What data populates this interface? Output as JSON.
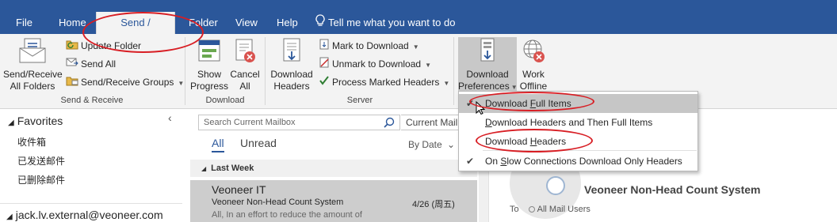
{
  "tabs": [
    {
      "label": "File"
    },
    {
      "label": "Home"
    },
    {
      "label": "Send / Receive"
    },
    {
      "label": "Folder"
    },
    {
      "label": "View"
    },
    {
      "label": "Help"
    }
  ],
  "tell_me": "Tell me what you want to do",
  "ribbon": {
    "send_receive_all": [
      "Send/Receive",
      "All Folders"
    ],
    "update_folder": "Update Folder",
    "send_all": "Send All",
    "send_receive_groups": "Send/Receive Groups",
    "group_send_receive": "Send & Receive",
    "show_progress": [
      "Show",
      "Progress"
    ],
    "cancel_all": [
      "Cancel",
      "All"
    ],
    "group_download": "Download",
    "download_headers": [
      "Download",
      "Headers"
    ],
    "mark_to_download": "Mark to Download",
    "unmark_to_download": "Unmark to Download",
    "process_marked_headers": "Process Marked Headers",
    "group_server": "Server",
    "download_preferences": [
      "Download",
      "Preferences"
    ],
    "work_offline": [
      "Work",
      "Offline"
    ]
  },
  "dropdown": {
    "item1": {
      "pre": "Download ",
      "u": "F",
      "post": "ull Items"
    },
    "item2": {
      "pre": "",
      "u": "D",
      "post": "ownload Headers and Then Full Items"
    },
    "item3": {
      "pre": "Download ",
      "u": "H",
      "post": "eaders"
    },
    "item4": {
      "pre": "On ",
      "u": "S",
      "post": "low Connections Download Only Headers"
    }
  },
  "folders": {
    "favorites": "Favorites",
    "items": [
      "收件箱",
      "已发送邮件",
      "已删除邮件"
    ],
    "account": "jack.lv.external@veoneer.com"
  },
  "mail_list": {
    "search_placeholder": "Search Current Mailbox",
    "scope": "Current Mailbox",
    "filter_all": "All",
    "filter_unread": "Unread",
    "sort": "By Date",
    "group": "Last Week",
    "message": {
      "from": "Veoneer IT",
      "subject": "Veoneer Non-Head Count System",
      "date": "4/26 (周五)",
      "preview": "All,  In an effort to reduce the amount of"
    }
  },
  "reading_pane": {
    "title": "Veoneer Non-Head Count System",
    "to_label": "To",
    "to_value": "All Mail Users"
  },
  "colors": {
    "accent": "#2b579a",
    "annotation": "#d81e24"
  }
}
